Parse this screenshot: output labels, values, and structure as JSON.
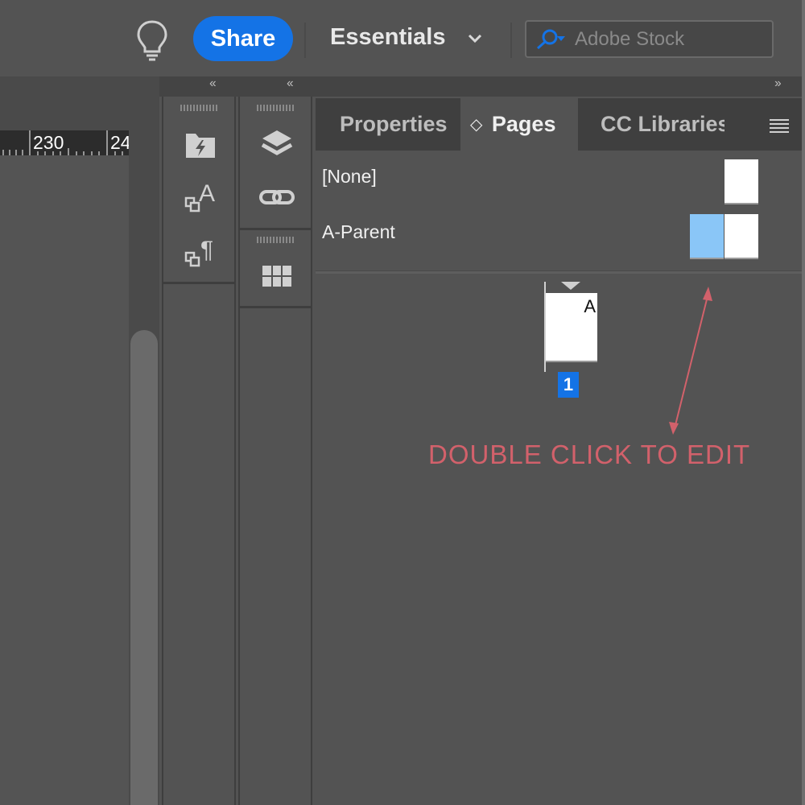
{
  "toolbar": {
    "share_label": "Share",
    "workspace_label": "Essentials",
    "search_placeholder": "Adobe Stock",
    "accent_color": "#1473e6"
  },
  "ruler": {
    "labels": [
      "230",
      "24"
    ]
  },
  "panel_strip": {
    "collapse_left": "‹‹",
    "collapse_mid": "‹‹",
    "collapse_right": "››",
    "icons_strip1": [
      "cc-libraries-folder-icon",
      "character-styles-icon",
      "paragraph-styles-icon"
    ],
    "icons_strip2": [
      "layers-icon",
      "links-icon",
      "swatches-table-icon"
    ]
  },
  "pages_panel": {
    "tabs": [
      {
        "label": "Properties"
      },
      {
        "label": "Pages",
        "glyph": "◇"
      },
      {
        "label": "CC Libraries"
      }
    ],
    "parents": [
      {
        "label": "[None]"
      },
      {
        "label": "A-Parent"
      }
    ],
    "page_letter": "A",
    "page_number": "1",
    "highlight_color": "#8ac6f7"
  },
  "annotation": {
    "text": "DOUBLE CLICK TO EDIT",
    "color": "#d2616b"
  }
}
